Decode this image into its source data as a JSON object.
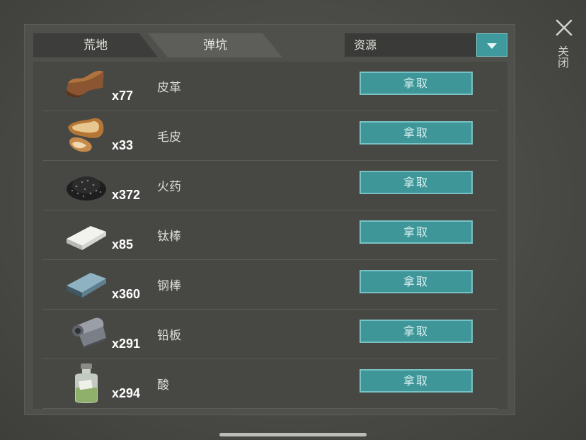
{
  "tabs": [
    {
      "label": "荒地"
    },
    {
      "label": "弹坑"
    }
  ],
  "filter": {
    "selected": "资源"
  },
  "close": {
    "label": "关闭"
  },
  "take_label": "拿取",
  "items": [
    {
      "name": "皮革",
      "count": "x77",
      "icon": "leather-icon"
    },
    {
      "name": "毛皮",
      "count": "x33",
      "icon": "fur-icon"
    },
    {
      "name": "火药",
      "count": "x372",
      "icon": "gunpowder-icon"
    },
    {
      "name": "钛棒",
      "count": "x85",
      "icon": "titanium-bar-icon"
    },
    {
      "name": "钢棒",
      "count": "x360",
      "icon": "steel-bar-icon"
    },
    {
      "name": "铅板",
      "count": "x291",
      "icon": "lead-sheet-icon"
    },
    {
      "name": "酸",
      "count": "x294",
      "icon": "acid-bottle-icon"
    }
  ],
  "colors": {
    "accent": "#3e9699",
    "accent_border": "#78c2c3",
    "panel": "#4f504c"
  }
}
